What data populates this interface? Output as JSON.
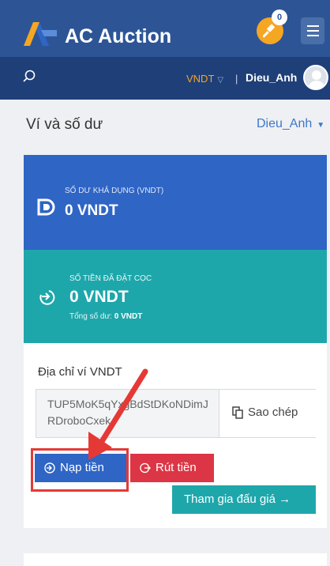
{
  "header": {
    "app_name": "AC Auction",
    "notification_count": "0"
  },
  "subbar": {
    "currency": "VNDT",
    "separator": "|",
    "username": "Dieu_Anh"
  },
  "page": {
    "title": "Ví và số dư",
    "account": "Dieu_Anh"
  },
  "balance": {
    "label": "SỐ DƯ KHẢ DỤNG (VNDT)",
    "value": "0 VNDT"
  },
  "deposit_held": {
    "label": "SỐ TIỀN ĐÃ ĐẶT CỌC",
    "value": "0 VNDT",
    "total_label": "Tổng số dư:",
    "total_value": "0 VNDT"
  },
  "wallet": {
    "label": "Địa chỉ ví VNDT",
    "address": "TUP5MoK5qYxgBdStDKoNDimJRDroboCxek",
    "copy_label": "Sao chép"
  },
  "actions": {
    "deposit_label": "Nạp tiền",
    "withdraw_label": "Rút tiền",
    "auction_label": "Tham gia đấu giá →"
  },
  "colors": {
    "header_bg": "#2d5596",
    "subbar_bg": "#1e3f78",
    "balance_bg": "#2f65c4",
    "deposit_bg": "#1ea7ab",
    "withdraw_bg": "#dc3545",
    "accent_orange": "#f5a623",
    "annotation_red": "#e53935"
  },
  "icons": {
    "logo": "ac-auction-logo",
    "gavel": "gavel-icon",
    "menu": "hamburger-menu-icon",
    "search": "search-icon",
    "balance": "balance-icon",
    "deposit": "deposit-circle-arrow-icon",
    "copy": "copy-icon"
  }
}
